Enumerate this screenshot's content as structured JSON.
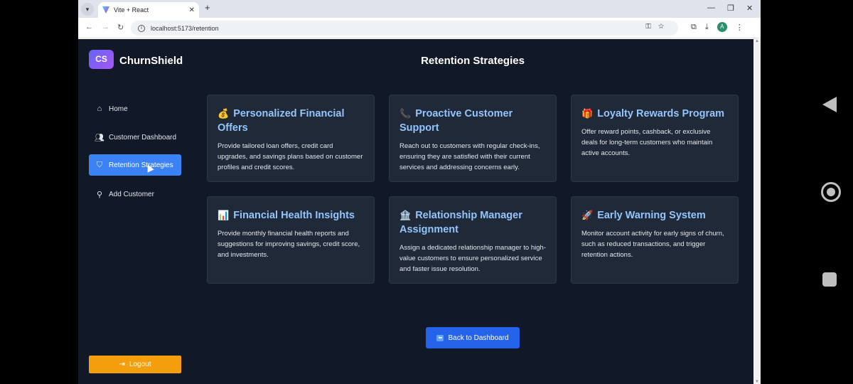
{
  "browser": {
    "tab_title": "Vite + React",
    "url": "localhost:5173/retention",
    "avatar_letter": "A"
  },
  "app": {
    "logo_initials": "CS",
    "logo_name": "ChurnShield",
    "page_title": "Retention Strategies"
  },
  "sidebar": {
    "items": [
      {
        "label": "Home",
        "icon": "home-icon"
      },
      {
        "label": "Customer Dashboard",
        "icon": "users-icon"
      },
      {
        "label": "Retention Strategies",
        "icon": "shield-icon",
        "active": true
      },
      {
        "label": "Add Customer",
        "icon": "user-plus-icon"
      }
    ],
    "logout_label": "Logout"
  },
  "cards": [
    {
      "emoji": "💰",
      "title": "Personalized Financial Offers",
      "desc": "Provide tailored loan offers, credit card upgrades, and savings plans based on customer profiles and credit scores."
    },
    {
      "emoji": "📞",
      "title": "Proactive Customer Support",
      "desc": "Reach out to customers with regular check-ins, ensuring they are satisfied with their current services and addressing concerns early."
    },
    {
      "emoji": "🎁",
      "title": "Loyalty Rewards Program",
      "desc": "Offer reward points, cashback, or exclusive deals for long-term customers who maintain active accounts."
    },
    {
      "emoji": "📊",
      "title": "Financial Health Insights",
      "desc": "Provide monthly financial health reports and suggestions for improving savings, credit score, and investments."
    },
    {
      "emoji": "🏦",
      "title": "Relationship Manager Assignment",
      "desc": "Assign a dedicated relationship manager to high-value customers to ensure personalized service and faster issue resolution."
    },
    {
      "emoji": "🚀",
      "title": "Early Warning System",
      "desc": "Monitor account activity for early signs of churn, such as reduced transactions, and trigger retention actions."
    }
  ],
  "back_button_label": "Back to Dashboard",
  "colors": {
    "accent": "#3b82f6",
    "card_title": "#93c5fd",
    "logout": "#f59e0b",
    "background": "#111827"
  }
}
